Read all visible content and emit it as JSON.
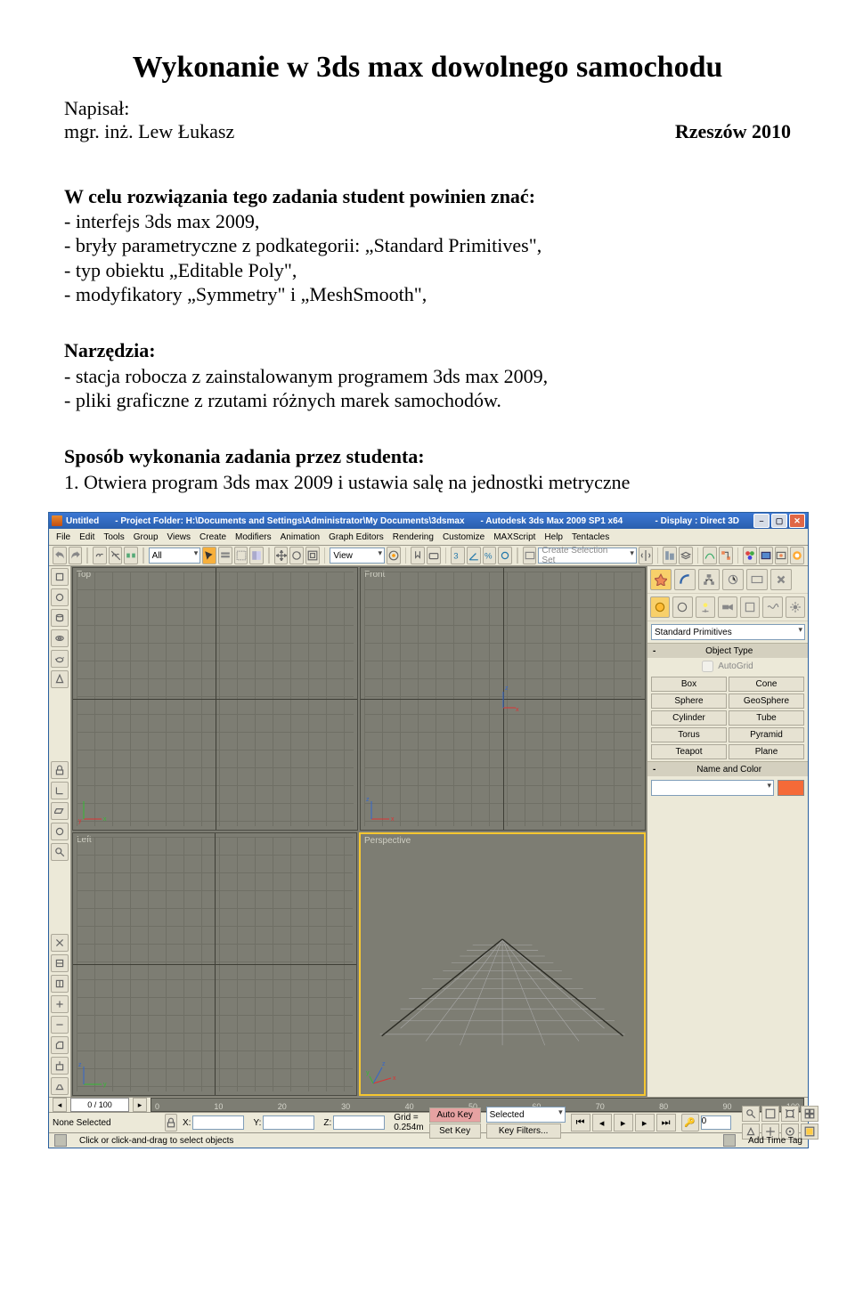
{
  "title": "Wykonanie w 3ds max dowolnego samochodu",
  "author": {
    "label": "Napisał:",
    "name": "mgr. inż. Lew Łukasz"
  },
  "date_location": "Rzeszów 2010",
  "sections": {
    "know_heading": "W celu rozwiązania tego zadania student powinien znać:",
    "know": [
      "- interfejs 3ds max 2009,",
      "- bryły parametryczne z podkategorii: „Standard Primitives\",",
      "- typ obiektu „Editable Poly\",",
      "- modyfikatory „Symmetry\" i „MeshSmooth\","
    ],
    "tools_heading": "Narzędzia:",
    "tools": [
      "- stacja robocza z zainstalowanym programem 3ds max 2009,",
      "- pliki graficzne z rzutami różnych marek samochodów."
    ],
    "method_heading": "Sposób wykonania zadania przez studenta:",
    "method": [
      "1.  Otwiera program 3ds max 2009 i ustawia salę na jednostki metryczne"
    ]
  },
  "shot": {
    "title_parts": {
      "file": "Untitled",
      "folder_label": "- Project Folder: H:\\Documents and Settings\\Administrator\\My Documents\\3dsmax",
      "app": "- Autodesk 3ds Max  2009 SP1  x64",
      "display": "- Display : Direct 3D"
    },
    "menu": [
      "File",
      "Edit",
      "Tools",
      "Group",
      "Views",
      "Create",
      "Modifiers",
      "Animation",
      "Graph Editors",
      "Rendering",
      "Customize",
      "MAXScript",
      "Help",
      "Tentacles"
    ],
    "toolbar": {
      "filter": "All",
      "view_combo": "View",
      "create_set_placeholder": "Create Selection Set"
    },
    "views": {
      "tl": "Top",
      "tr": "Front",
      "bl": "Left",
      "br": "Perspective"
    },
    "axes": {
      "x": "x",
      "y": "y",
      "z": "z"
    },
    "right": {
      "category": "Standard Primitives",
      "object_type_head": "Object Type",
      "autogrid": "AutoGrid",
      "objects": [
        "Box",
        "Cone",
        "Sphere",
        "GeoSphere",
        "Cylinder",
        "Tube",
        "Torus",
        "Pyramid",
        "Teapot",
        "Plane"
      ],
      "name_color_head": "Name and Color",
      "swatch": "#f56a38"
    },
    "timeline": {
      "frame": "0 / 100",
      "ticks": [
        "0",
        "10",
        "20",
        "30",
        "40",
        "50",
        "60",
        "70",
        "80",
        "90",
        "100"
      ]
    },
    "status": {
      "selection": "None Selected",
      "x": "X:",
      "y": "Y:",
      "z": "Z:",
      "grid": "Grid = 0.254m",
      "autokey": "Auto Key",
      "keymode_label": "Selected",
      "setkey": "Set Key",
      "keyfilters": "Key Filters...",
      "framefield": "0"
    },
    "hint": {
      "left": "Click or click-and-drag to select objects",
      "addtag": "Add Time Tag"
    }
  }
}
